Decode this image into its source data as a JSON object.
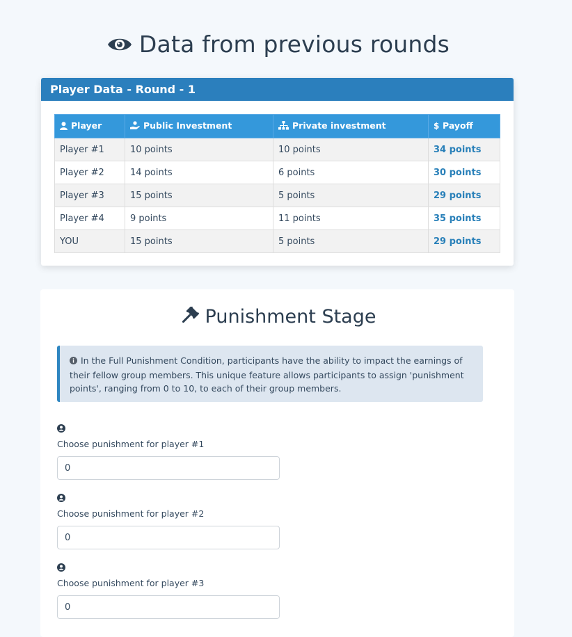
{
  "page": {
    "title": "Data from previous rounds"
  },
  "data_card": {
    "header": "Player Data - Round - 1",
    "columns": [
      "Player",
      "Public Investment",
      "Private investment",
      "Payoff"
    ],
    "rows": [
      {
        "player": "Player #1",
        "public": "10 points",
        "private": "10 points",
        "payoff": "34 points"
      },
      {
        "player": "Player #2",
        "public": "14 points",
        "private": "6 points",
        "payoff": "30 points"
      },
      {
        "player": "Player #3",
        "public": "15 points",
        "private": "5 points",
        "payoff": "29 points"
      },
      {
        "player": "Player #4",
        "public": "9 points",
        "private": "11 points",
        "payoff": "35 points"
      },
      {
        "player": "YOU",
        "public": "15 points",
        "private": "5 points",
        "payoff": "29 points"
      }
    ]
  },
  "punishment": {
    "title": "Punishment Stage",
    "info": "In the Full Punishment Condition, participants have the ability to impact the earnings of their fellow group members. This unique feature allows participants to assign 'punishment points', ranging from 0 to 10, to each of their group members.",
    "fields": [
      {
        "label": "Choose punishment for player #1",
        "value": "0"
      },
      {
        "label": "Choose punishment for player #2",
        "value": "0"
      },
      {
        "label": "Choose punishment for player #3",
        "value": "0"
      }
    ]
  },
  "colors": {
    "header": "#2b7fbd",
    "table_head": "#3498db",
    "payoff": "#2980b9",
    "info_border": "#2e86c1"
  }
}
